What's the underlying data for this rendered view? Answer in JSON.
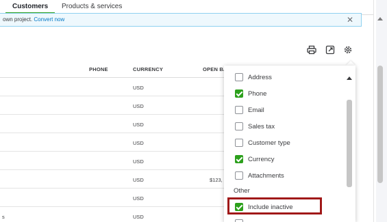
{
  "tabs": [
    {
      "label": "Customers",
      "active": true
    },
    {
      "label": "Products & services",
      "active": false
    }
  ],
  "banner": {
    "text": "own project.",
    "link": "Convert now",
    "close_icon": "close-icon"
  },
  "toolbar": {
    "icons": [
      "print-icon",
      "export-icon",
      "gear-icon"
    ]
  },
  "table": {
    "columns": [
      "PHONE",
      "CURRENCY",
      "OPEN BA"
    ],
    "rows": [
      {
        "left": "",
        "currency": "USD",
        "balance": ""
      },
      {
        "left": "",
        "currency": "USD",
        "balance": ""
      },
      {
        "left": "",
        "currency": "USD",
        "balance": ""
      },
      {
        "left": "",
        "currency": "USD",
        "balance": ""
      },
      {
        "left": "",
        "currency": "USD",
        "balance": ""
      },
      {
        "left": "",
        "currency": "USD",
        "balance": "$123,"
      },
      {
        "left": "",
        "currency": "USD",
        "balance": ""
      },
      {
        "left": "s",
        "currency": "USD",
        "balance": ""
      }
    ]
  },
  "settings_panel": {
    "options": [
      {
        "label": "Address",
        "checked": false
      },
      {
        "label": "Phone",
        "checked": true
      },
      {
        "label": "Email",
        "checked": false
      },
      {
        "label": "Sales tax",
        "checked": false
      },
      {
        "label": "Customer type",
        "checked": false
      },
      {
        "label": "Currency",
        "checked": true
      },
      {
        "label": "Attachments",
        "checked": false
      }
    ],
    "group_label": "Other",
    "other_options": [
      {
        "label": "Include inactive",
        "checked": true
      },
      {
        "label": "",
        "checked": false
      }
    ]
  },
  "colors": {
    "accent_green": "#2ca01c",
    "link_blue": "#0077c5",
    "highlight_red": "#a01818",
    "banner_bg": "#eef8fd"
  }
}
